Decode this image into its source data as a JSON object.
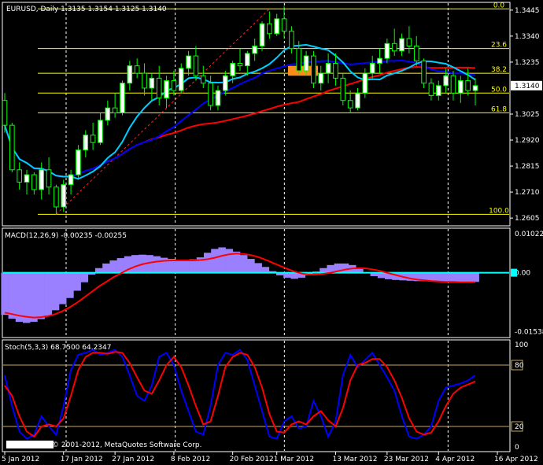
{
  "symbol_info": "EURUSD, Daily  1.3135 1.3154 1.3125 1.3140",
  "copyright": "© 2001-2012, MetaQuotes Software Corp.",
  "colors": {
    "background": "#000000",
    "border": "#ffffff",
    "text": "#ffffff",
    "bull_candle": "#ffffff",
    "bear_candle": "#000000",
    "candle_outline": "#00ff00",
    "fib_lines": "#ffff00",
    "fib_labels": "#ffff00",
    "ma_slow": "#ff0000",
    "ma_mid": "#0000ff",
    "ma_fast": "#00ccff",
    "trendline": "#ff2020",
    "vline": "#ffffff",
    "box": "#ff8c1a",
    "macd_hist": "#9a80ff",
    "macd_signal": "#ff0000",
    "macd_zero": "#00ffff",
    "stoch_main": "#0000ff",
    "stoch_signal": "#ff0000",
    "stoch_levels": "#c8aa60",
    "price_label_bg": "#ffffff",
    "price_label_text": "#000000"
  },
  "fib_labels": [
    "0.0",
    "23.6",
    "38.2",
    "50.0",
    "61.8",
    "100.0"
  ],
  "macd": {
    "label": "MACD(12,26,9) -0.00235 -0.00255"
  },
  "stoch": {
    "label": "Stoch(5,3,3) 68.7500 64.2347"
  },
  "chart_data": [
    {
      "type": "candlestick",
      "panel": "price",
      "y_ticks": [
        "1.3445",
        "1.3340",
        "1.3235",
        "1.3025",
        "1.2920",
        "1.2815",
        "1.2710",
        "1.2605"
      ],
      "ylim": [
        1.258,
        1.347
      ],
      "current_price": "1.3140",
      "fib_levels": [
        {
          "label": "0.0",
          "value": 1.345
        },
        {
          "label": "23.6",
          "value": 1.329
        },
        {
          "label": "38.2",
          "value": 1.319
        },
        {
          "label": "50.0",
          "value": 1.311
        },
        {
          "label": "61.8",
          "value": 1.303
        },
        {
          "label": "100.0",
          "value": 1.262
        }
      ],
      "ohlc": [
        [
          1.308,
          1.311,
          1.295,
          1.298
        ],
        [
          1.298,
          1.299,
          1.279,
          1.28
        ],
        [
          1.28,
          1.283,
          1.272,
          1.275
        ],
        [
          1.275,
          1.28,
          1.27,
          1.278
        ],
        [
          1.278,
          1.279,
          1.27,
          1.272
        ],
        [
          1.272,
          1.283,
          1.268,
          1.28
        ],
        [
          1.28,
          1.285,
          1.27,
          1.273
        ],
        [
          1.273,
          1.274,
          1.262,
          1.265
        ],
        [
          1.265,
          1.276,
          1.263,
          1.274
        ],
        [
          1.274,
          1.28,
          1.27,
          1.278
        ],
        [
          1.278,
          1.29,
          1.276,
          1.288
        ],
        [
          1.288,
          1.296,
          1.285,
          1.294
        ],
        [
          1.294,
          1.299,
          1.288,
          1.291
        ],
        [
          1.291,
          1.303,
          1.29,
          1.3
        ],
        [
          1.3,
          1.308,
          1.298,
          1.305
        ],
        [
          1.305,
          1.311,
          1.301,
          1.303
        ],
        [
          1.303,
          1.316,
          1.302,
          1.315
        ],
        [
          1.315,
          1.324,
          1.312,
          1.322
        ],
        [
          1.322,
          1.325,
          1.317,
          1.319
        ],
        [
          1.319,
          1.323,
          1.31,
          1.313
        ],
        [
          1.313,
          1.319,
          1.308,
          1.317
        ],
        [
          1.317,
          1.322,
          1.306,
          1.309
        ],
        [
          1.309,
          1.318,
          1.305,
          1.316
        ],
        [
          1.316,
          1.32,
          1.31,
          1.312
        ],
        [
          1.312,
          1.323,
          1.311,
          1.321
        ],
        [
          1.321,
          1.328,
          1.318,
          1.326
        ],
        [
          1.326,
          1.33,
          1.316,
          1.318
        ],
        [
          1.318,
          1.322,
          1.313,
          1.315
        ],
        [
          1.315,
          1.318,
          1.304,
          1.306
        ],
        [
          1.306,
          1.314,
          1.304,
          1.312
        ],
        [
          1.312,
          1.32,
          1.31,
          1.318
        ],
        [
          1.318,
          1.324,
          1.315,
          1.323
        ],
        [
          1.323,
          1.329,
          1.32,
          1.322
        ],
        [
          1.322,
          1.328,
          1.318,
          1.327
        ],
        [
          1.327,
          1.333,
          1.324,
          1.33
        ],
        [
          1.33,
          1.34,
          1.328,
          1.339
        ],
        [
          1.339,
          1.344,
          1.333,
          1.335
        ],
        [
          1.335,
          1.343,
          1.334,
          1.341
        ],
        [
          1.341,
          1.346,
          1.333,
          1.336
        ],
        [
          1.336,
          1.338,
          1.327,
          1.329
        ],
        [
          1.329,
          1.332,
          1.318,
          1.32
        ],
        [
          1.32,
          1.328,
          1.318,
          1.326
        ],
        [
          1.326,
          1.328,
          1.313,
          1.315
        ],
        [
          1.315,
          1.322,
          1.312,
          1.319
        ],
        [
          1.319,
          1.327,
          1.315,
          1.323
        ],
        [
          1.323,
          1.327,
          1.314,
          1.317
        ],
        [
          1.317,
          1.319,
          1.306,
          1.308
        ],
        [
          1.308,
          1.312,
          1.303,
          1.305
        ],
        [
          1.305,
          1.313,
          1.304,
          1.311
        ],
        [
          1.311,
          1.321,
          1.309,
          1.319
        ],
        [
          1.319,
          1.326,
          1.317,
          1.323
        ],
        [
          1.323,
          1.329,
          1.319,
          1.325
        ],
        [
          1.325,
          1.333,
          1.323,
          1.331
        ],
        [
          1.331,
          1.337,
          1.326,
          1.328
        ],
        [
          1.328,
          1.335,
          1.326,
          1.333
        ],
        [
          1.333,
          1.338,
          1.327,
          1.33
        ],
        [
          1.33,
          1.334,
          1.322,
          1.324
        ],
        [
          1.324,
          1.325,
          1.313,
          1.315
        ],
        [
          1.315,
          1.317,
          1.308,
          1.31
        ],
        [
          1.31,
          1.316,
          1.308,
          1.314
        ],
        [
          1.314,
          1.321,
          1.311,
          1.318
        ],
        [
          1.318,
          1.32,
          1.308,
          1.311
        ],
        [
          1.311,
          1.318,
          1.307,
          1.316
        ],
        [
          1.316,
          1.321,
          1.31,
          1.312
        ],
        [
          1.312,
          1.317,
          1.306,
          1.314
        ]
      ],
      "x_ticks": [
        "5 Jan 2012",
        "17 Jan 2012",
        "27 Jan 2012",
        "8 Feb 2012",
        "20 Feb 2012",
        "1 Mar 2012",
        "13 Mar 2012",
        "23 Mar 2012",
        "4 Apr 2012",
        "16 Apr 2012"
      ],
      "x_tick_bar_index": [
        0,
        8,
        15,
        23,
        31,
        37,
        45,
        52,
        59,
        67
      ]
    },
    {
      "type": "bar+line",
      "panel": "macd",
      "y_ticks": [
        "0.01022",
        "0.00",
        "-0.01538"
      ],
      "ylim": [
        -0.0165,
        0.0112
      ],
      "histogram": [
        -0.011,
        -0.012,
        -0.0128,
        -0.0131,
        -0.0128,
        -0.0121,
        -0.0112,
        -0.0098,
        -0.0082,
        -0.0066,
        -0.0047,
        -0.0025,
        -0.0005,
        0.0012,
        0.0024,
        0.0032,
        0.0038,
        0.0043,
        0.0046,
        0.0047,
        0.0046,
        0.0043,
        0.0039,
        0.0036,
        0.0034,
        0.0034,
        0.0035,
        0.004,
        0.0052,
        0.0062,
        0.0066,
        0.0062,
        0.0055,
        0.0046,
        0.0036,
        0.0025,
        0.0015,
        0.0004,
        -0.0007,
        -0.0013,
        -0.0016,
        -0.0013,
        -0.0007,
        0.0003,
        0.0012,
        0.002,
        0.0024,
        0.0024,
        0.002,
        0.0011,
        0.0,
        -0.0009,
        -0.0014,
        -0.0017,
        -0.0019,
        -0.002,
        -0.0021,
        -0.0022,
        -0.0022,
        -0.0023,
        -0.0023,
        -0.0023,
        -0.0024,
        -0.0024,
        -0.0024,
        -0.0024
      ],
      "signal": [
        -0.0104,
        -0.0108,
        -0.0112,
        -0.0115,
        -0.0117,
        -0.0116,
        -0.0113,
        -0.0108,
        -0.01,
        -0.009,
        -0.0078,
        -0.0064,
        -0.005,
        -0.0036,
        -0.0024,
        -0.0012,
        -0.0002,
        0.0008,
        0.0016,
        0.0022,
        0.0026,
        0.0029,
        0.0031,
        0.0032,
        0.0032,
        0.0032,
        0.0032,
        0.0033,
        0.0035,
        0.0039,
        0.0044,
        0.0048,
        0.005,
        0.0049,
        0.0046,
        0.0041,
        0.0034,
        0.0026,
        0.0018,
        0.001,
        0.0003,
        -0.0002,
        -0.0005,
        -0.0005,
        -0.0003,
        0.0,
        0.0004,
        0.0008,
        0.0011,
        0.0012,
        0.0011,
        0.0008,
        0.0004,
        -0.0001,
        -0.0006,
        -0.0011,
        -0.0015,
        -0.0018,
        -0.002,
        -0.0022,
        -0.0023,
        -0.0024,
        -0.0024,
        -0.0025,
        -0.0025,
        -0.0025
      ]
    },
    {
      "type": "line",
      "panel": "stochastic",
      "y_ticks": [
        "100",
        "80",
        "20",
        "0"
      ],
      "ylim": [
        0,
        100
      ],
      "levels": [
        80,
        20
      ],
      "main": [
        70,
        40,
        15,
        8,
        12,
        30,
        20,
        12,
        40,
        75,
        90,
        92,
        95,
        90,
        92,
        95,
        88,
        70,
        50,
        45,
        60,
        88,
        92,
        80,
        55,
        35,
        15,
        12,
        40,
        80,
        92,
        90,
        95,
        85,
        60,
        35,
        10,
        8,
        25,
        30,
        18,
        20,
        45,
        30,
        10,
        25,
        70,
        90,
        78,
        85,
        92,
        80,
        68,
        55,
        30,
        10,
        8,
        12,
        20,
        45,
        58,
        60,
        62,
        65,
        70
      ],
      "signal": [
        60,
        50,
        30,
        15,
        10,
        20,
        22,
        20,
        28,
        50,
        75,
        88,
        92,
        92,
        91,
        93,
        92,
        82,
        68,
        55,
        52,
        65,
        80,
        88,
        78,
        60,
        40,
        22,
        25,
        50,
        78,
        88,
        92,
        90,
        78,
        58,
        32,
        15,
        14,
        22,
        25,
        22,
        30,
        35,
        26,
        20,
        38,
        65,
        80,
        82,
        86,
        86,
        78,
        65,
        48,
        28,
        15,
        12,
        14,
        25,
        40,
        52,
        58,
        61,
        64
      ]
    }
  ]
}
